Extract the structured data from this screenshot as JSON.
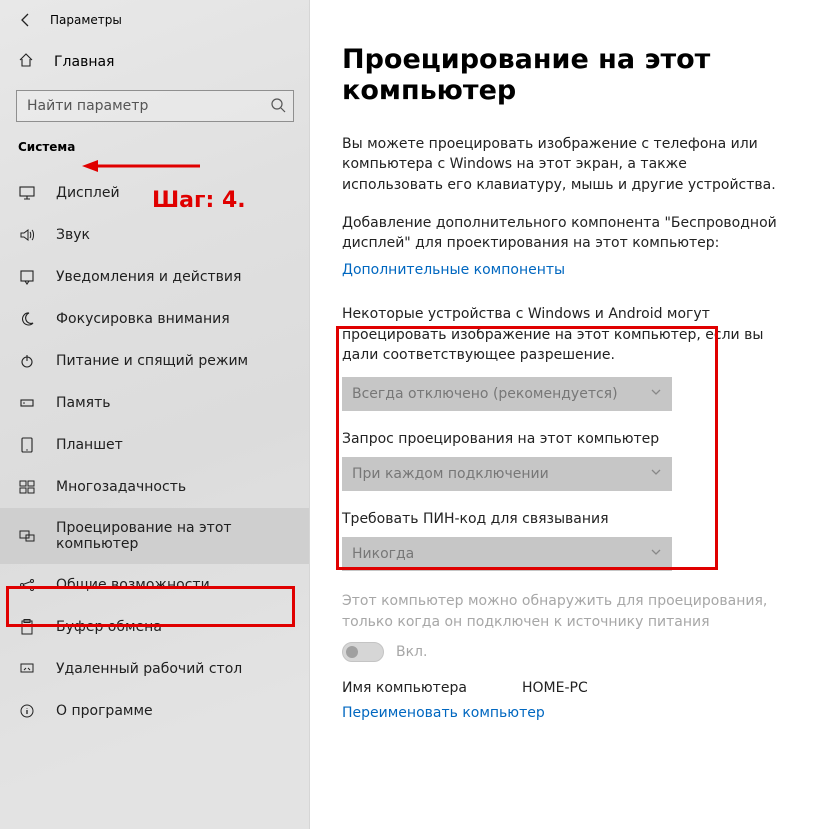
{
  "header": {
    "back_aria": "Назад",
    "title": "Параметры"
  },
  "home_label": "Главная",
  "search": {
    "placeholder": "Найти параметр"
  },
  "category": "Система",
  "nav": {
    "items": [
      {
        "label": "Дисплей"
      },
      {
        "label": "Звук"
      },
      {
        "label": "Уведомления и действия"
      },
      {
        "label": "Фокусировка внимания"
      },
      {
        "label": "Питание и спящий режим"
      },
      {
        "label": "Память"
      },
      {
        "label": "Планшет"
      },
      {
        "label": "Многозадачность"
      },
      {
        "label": "Проецирование на этот компьютер"
      },
      {
        "label": "Общие возможности"
      },
      {
        "label": "Буфер обмена"
      },
      {
        "label": "Удаленный рабочий стол"
      },
      {
        "label": "О программе"
      }
    ]
  },
  "main": {
    "title": "Проецирование на этот компьютер",
    "intro": "Вы можете проецировать изображение с телефона или компьютера с Windows на этот экран, а также использовать его клавиатуру, мышь и другие устройства.",
    "note": "Добавление дополнительного компонента \"Беспроводной дисплей\" для проектирования на этот компьютер:",
    "link": "Дополнительные компоненты",
    "perm_desc": "Некоторые устройства с Windows и Android могут проецировать изображение на этот компьютер, если вы дали соответствующее разрешение.",
    "dd1_value": "Всегда отключено (рекомендуется)",
    "dd2_label": "Запрос проецирования на этот компьютер",
    "dd2_value": "При каждом подключении",
    "dd3_label": "Требовать ПИН-код для связывания",
    "dd3_value": "Никогда",
    "power_note": "Этот компьютер можно обнаружить для проецирования, только когда он подключен к источнику питания",
    "toggle_label": "Вкл.",
    "pcname_label": "Имя компьютера",
    "pcname_value": "HOME-PC",
    "rename_link": "Переименовать компьютер"
  },
  "annotation": {
    "step": "Шаг: 4."
  }
}
